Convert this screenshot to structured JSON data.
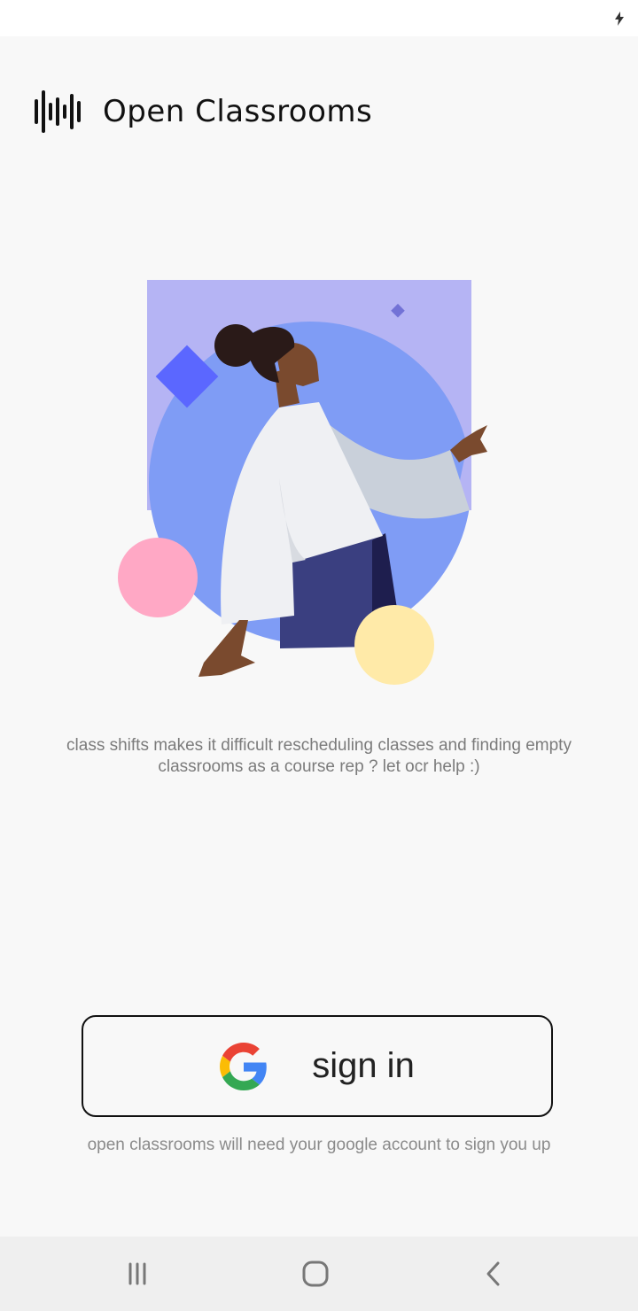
{
  "app": {
    "title": "Open Classrooms"
  },
  "status_bar": {
    "icons": [
      "charging-icon"
    ]
  },
  "main": {
    "tagline": "class shifts makes it difficult rescheduling classes and finding empty classrooms as a course rep ? let ocr help :)"
  },
  "signin": {
    "label": "sign in",
    "icon": "google-icon",
    "note": "open classrooms will need your google account to sign you up"
  },
  "navigation": {
    "buttons": [
      "recents-icon",
      "home-icon",
      "back-icon"
    ]
  },
  "colors": {
    "background": "#f8f8f8",
    "illustration_square": "#b5b4f4",
    "illustration_circle": "#7f9cf5",
    "pink_circle": "#ffa8c5",
    "yellow_circle": "#ffeaa8",
    "diamond": "#5b67ff",
    "button_border": "#111111"
  }
}
